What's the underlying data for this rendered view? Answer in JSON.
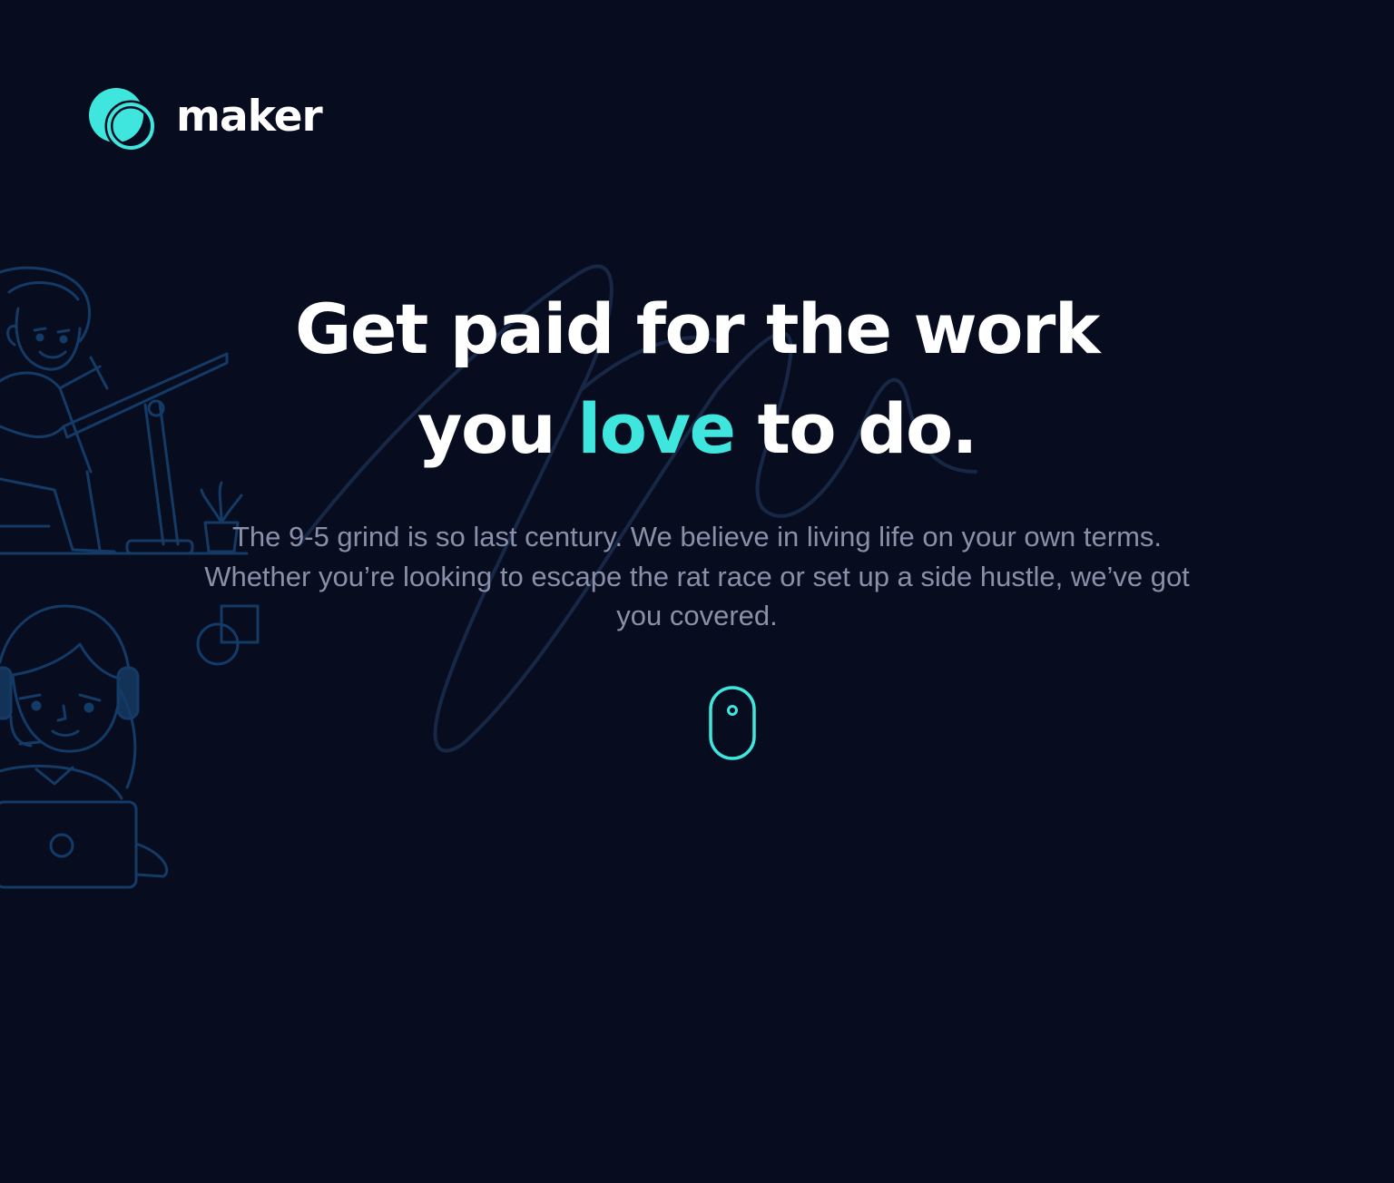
{
  "brand": {
    "name": "maker",
    "icon": "maker-logo-icon",
    "accent_color": "#3ee6de",
    "background_color": "#070c1f"
  },
  "hero": {
    "headline_part1": "Get paid for the work you ",
    "headline_accent": "love",
    "headline_part2": " to do.",
    "subtext": "The 9-5 grind is so last century. We believe in living life on your own terms. Whether you’re looking to escape the rat race or set up a side hustle, we’ve got you covered."
  },
  "scroll_indicator": {
    "icon": "mouse-scroll-icon"
  },
  "illustrations": {
    "top_left": "person-drawing-at-desk",
    "bottom_left": "person-with-headset-laptop",
    "background": "signature-scribble"
  }
}
